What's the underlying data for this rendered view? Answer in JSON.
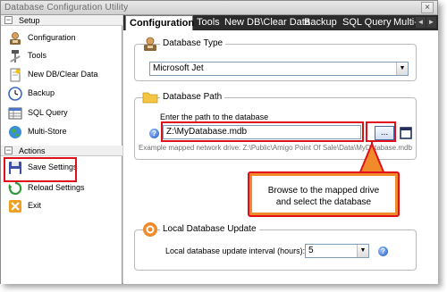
{
  "window": {
    "title": "Database Configuration Utility",
    "close_glyph": "×"
  },
  "sidebar": {
    "setup_header": "Setup",
    "setup_items": [
      {
        "label": "Configuration",
        "icon": "configuration-icon"
      },
      {
        "label": "Tools",
        "icon": "tools-icon"
      },
      {
        "label": "New DB/Clear Data",
        "icon": "new-db-icon"
      },
      {
        "label": "Backup",
        "icon": "backup-clock-icon"
      },
      {
        "label": "SQL Query",
        "icon": "sql-query-icon"
      },
      {
        "label": "Multi-Store",
        "icon": "globe-icon"
      }
    ],
    "actions_header": "Actions",
    "action_items": [
      {
        "label": "Save Settings",
        "icon": "save-disk-icon"
      },
      {
        "label": "Reload Settings",
        "icon": "reload-icon"
      },
      {
        "label": "Exit",
        "icon": "exit-icon"
      }
    ],
    "toggle_glyph": "⊟"
  },
  "tabs": [
    "Configuration",
    "Tools",
    "New DB\\Clear Data",
    "Backup",
    "SQL Query",
    "Multi-S"
  ],
  "tab_scroll": {
    "left": "◄",
    "right": "►"
  },
  "database_type": {
    "title": "Database Type",
    "selected": "Microsoft Jet",
    "arrow": "▼"
  },
  "database_path": {
    "title": "Database Path",
    "prompt": "Enter the path to the database",
    "value": "Z:\\MyDatabase.mdb",
    "browse_label": "...",
    "example": "Example mapped network drive:  Z:\\Public\\Amigo Point Of Sale\\Data\\MyDatabase.mdb",
    "help": "?"
  },
  "callout": {
    "line1": "Browse to the mapped drive",
    "line2": "and select the database"
  },
  "local_update": {
    "title": "Local Database Update",
    "label": "Local database update interval (hours):",
    "value": "5",
    "arrow": "▼",
    "help": "?"
  },
  "colors": {
    "highlight": "#e0101a",
    "callout_fill": "#f08a2b",
    "tab_strip": "#2b2b2b"
  }
}
